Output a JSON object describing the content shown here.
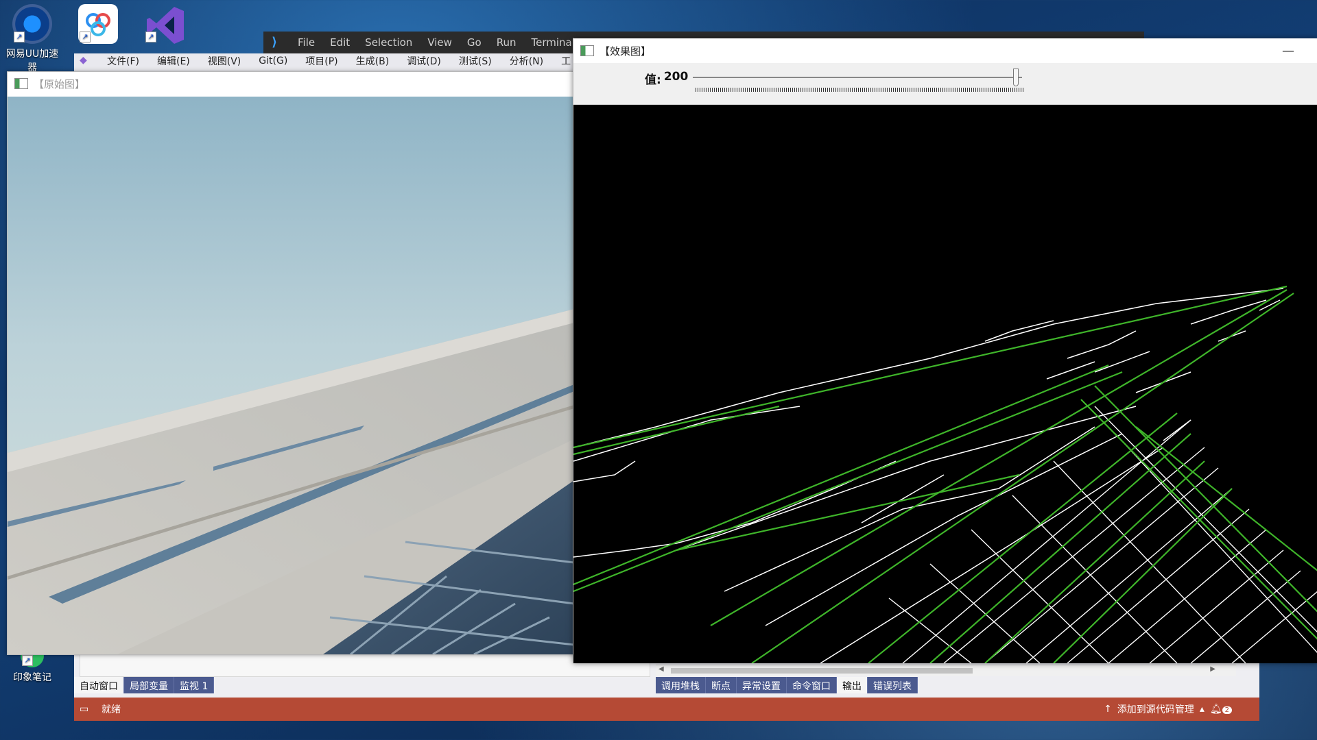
{
  "desktop": {
    "icons": [
      {
        "label": "网易UU加速器",
        "icon": "uu-accelerator-icon"
      },
      {
        "label": "",
        "icon": "baidu-netdisk-icon"
      },
      {
        "label": "",
        "icon": "visual-studio-icon"
      },
      {
        "label": "印象笔记",
        "icon": "evernote-icon"
      }
    ]
  },
  "vscode": {
    "menu": [
      "File",
      "Edit",
      "Selection",
      "View",
      "Go",
      "Run",
      "Terminal"
    ]
  },
  "vs": {
    "menu": [
      "文件(F)",
      "编辑(E)",
      "视图(V)",
      "Git(G)",
      "项目(P)",
      "生成(B)",
      "调试(D)",
      "测试(S)",
      "分析(N)",
      "工"
    ],
    "left_tabs": [
      "自动窗口",
      "局部变量",
      "监视 1"
    ],
    "right_tabs": [
      "调用堆栈",
      "断点",
      "异常设置",
      "命令窗口",
      "输出",
      "错误列表"
    ],
    "active_right_tab": "输出",
    "status_ready": "就绪",
    "status_source_control": "添加到源代码管理",
    "notification_count": "2"
  },
  "original_window": {
    "title": "【原始图】"
  },
  "effect_window": {
    "title": "【效果图】",
    "minimize_symbol": "—",
    "slider_label": "值:",
    "slider_value": "200",
    "slider_fraction": 0.98
  },
  "colors": {
    "status_bar": "#b54a35",
    "tab_bar": "#4b5a8f",
    "hough_line": "#3fb52a",
    "edge_line": "#ffffff"
  }
}
